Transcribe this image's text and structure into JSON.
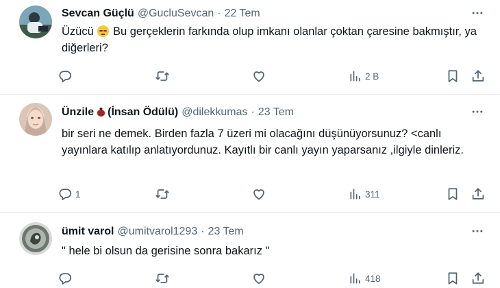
{
  "tweets": [
    {
      "name": "Sevcan Güçlü",
      "handle": "@GucluSevcan",
      "date": "22 Tem",
      "text_before_emoji": "Üzücü",
      "text_after_emoji": " Bu gerçeklerin farkında olup imkanı olanlar çoktan çaresine bakmıştır, ya diğerleri?",
      "emoji": "pensive-face",
      "reply_count": "",
      "retweet_count": "",
      "like_count": "",
      "view_count": "2 B"
    },
    {
      "name_part1": "Ünzile",
      "name_part2": "(İnsan Ödülü)",
      "name_emoji": "ladybug",
      "handle": "@dilekkumas",
      "date": "23 Tem",
      "text": "bir seri ne demek. Birden fazla 7 üzeri mi olacağını düşünüyorsunuz? <canlı yayınlara katılıp anlatıyordunuz. Kayıtlı bir canlı yayın yaparsanız ,ilgiyle dinleriz.",
      "reply_count": "1",
      "retweet_count": "",
      "like_count": "",
      "view_count": "311"
    },
    {
      "name": "ümit varol",
      "handle": "@umitvarol1293",
      "date": "23 Tem",
      "text": "\" hele bi olsun da gerisine sonra bakarız \"",
      "reply_count": "",
      "retweet_count": "",
      "like_count": "",
      "view_count": "418"
    }
  ],
  "ui": {
    "separator": "·",
    "icon_color": "#536471",
    "divider_color": "#e6e9ec"
  }
}
